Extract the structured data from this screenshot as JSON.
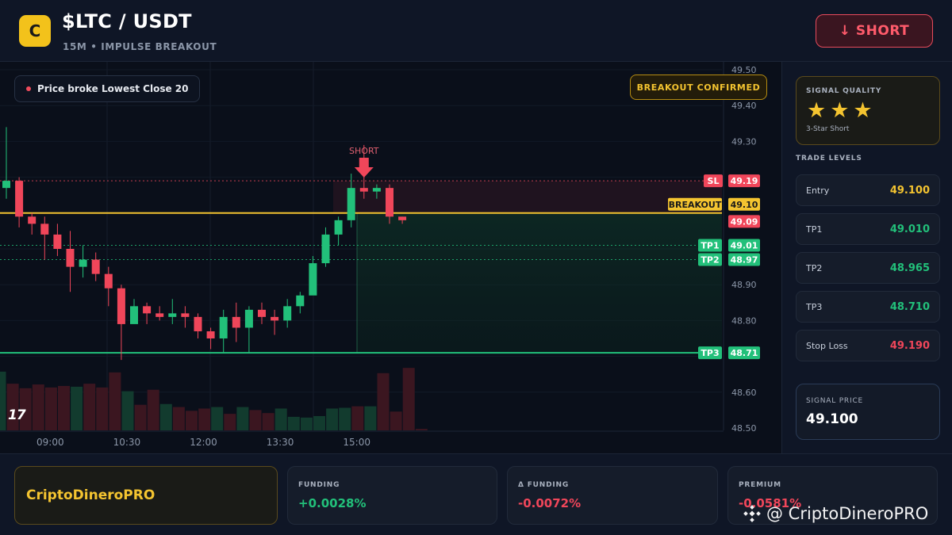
{
  "header": {
    "logo_letter": "C",
    "title": "$LTC / USDT",
    "subtitle": "15M • IMPULSE BREAKOUT",
    "short_button": "↓ SHORT"
  },
  "chart": {
    "signal_chip": "Price broke Lowest Close 20",
    "breakout_chip": "BREAKOUT CONFIRMED",
    "short_marker": "SHORT",
    "tv_logo": "17",
    "colors": {
      "up": "#22c07a",
      "down": "#f0465a",
      "breakout": "#f4c430",
      "tp": "#22c07a"
    }
  },
  "chart_data": {
    "type": "candlestick",
    "y_axis": {
      "ylim": [
        48.5,
        49.5
      ],
      "ticks": [
        "49.50",
        "49.40",
        "49.30",
        "48.90",
        "48.80",
        "48.60",
        "48.50"
      ]
    },
    "x_axis": {
      "ticks": [
        {
          "label": "09:00",
          "index": 3
        },
        {
          "label": "10:30",
          "index": 9
        },
        {
          "label": "12:00",
          "index": 15
        },
        {
          "label": "13:30",
          "index": 21
        },
        {
          "label": "15:00",
          "index": 27
        }
      ]
    },
    "candles": [
      [
        49.17,
        49.19,
        49.14,
        49.34
      ],
      [
        49.19,
        49.09,
        49.06,
        49.2
      ],
      [
        49.09,
        49.07,
        49.04,
        49.1
      ],
      [
        49.07,
        49.04,
        48.97,
        49.09
      ],
      [
        49.04,
        49.0,
        48.98,
        49.07
      ],
      [
        49.0,
        48.95,
        48.88,
        49.05
      ],
      [
        48.95,
        48.97,
        48.92,
        49.01
      ],
      [
        48.97,
        48.93,
        48.91,
        48.99
      ],
      [
        48.93,
        48.89,
        48.84,
        48.95
      ],
      [
        48.89,
        48.79,
        48.69,
        48.9
      ],
      [
        48.79,
        48.84,
        48.82,
        48.86
      ],
      [
        48.84,
        48.82,
        48.79,
        48.85
      ],
      [
        48.82,
        48.81,
        48.8,
        48.84
      ],
      [
        48.81,
        48.82,
        48.79,
        48.86
      ],
      [
        48.82,
        48.81,
        48.78,
        48.84
      ],
      [
        48.81,
        48.77,
        48.75,
        48.82
      ],
      [
        48.77,
        48.75,
        48.72,
        48.78
      ],
      [
        48.75,
        48.81,
        48.71,
        48.83
      ],
      [
        48.81,
        48.78,
        48.74,
        48.85
      ],
      [
        48.78,
        48.83,
        48.71,
        48.84
      ],
      [
        48.83,
        48.81,
        48.79,
        48.85
      ],
      [
        48.81,
        48.8,
        48.76,
        48.83
      ],
      [
        48.8,
        48.84,
        48.78,
        48.86
      ],
      [
        48.84,
        48.87,
        48.82,
        48.88
      ],
      [
        48.87,
        48.96,
        48.94,
        48.98
      ],
      [
        48.96,
        49.04,
        48.95,
        49.06
      ],
      [
        49.04,
        49.08,
        49.01,
        49.09
      ],
      [
        49.08,
        49.17,
        49.06,
        49.21
      ],
      [
        49.17,
        49.16,
        49.14,
        49.29
      ],
      [
        49.16,
        49.17,
        49.14,
        49.18
      ],
      [
        49.17,
        49.09,
        49.07,
        49.18
      ],
      [
        49.09,
        49.08,
        49.07,
        49.09
      ]
    ],
    "volume": [
      0.78,
      0.62,
      0.56,
      0.61,
      0.57,
      0.59,
      0.58,
      0.62,
      0.57,
      0.77,
      0.52,
      0.34,
      0.54,
      0.35,
      0.31,
      0.26,
      0.29,
      0.31,
      0.22,
      0.31,
      0.27,
      0.23,
      0.29,
      0.18,
      0.17,
      0.19,
      0.29,
      0.3,
      0.32,
      0.32,
      0.76,
      0.25,
      0.83,
      0.02
    ],
    "levels": {
      "sl": {
        "label": "SL",
        "value": "49.19",
        "price": 49.19
      },
      "breakout": {
        "label": "BREAKOUT",
        "value": "49.10",
        "price": 49.1
      },
      "current": {
        "value": "49.09",
        "price": 49.09
      },
      "tp1": {
        "label": "TP1",
        "value": "49.01",
        "price": 49.01
      },
      "tp2": {
        "label": "TP2",
        "value": "48.97",
        "price": 48.97
      },
      "tp3": {
        "label": "TP3",
        "value": "48.71",
        "price": 48.71
      }
    }
  },
  "side": {
    "quality_label": "SIGNAL QUALITY",
    "stars": "★★★",
    "quality_sub": "3-Star Short",
    "levels_title": "TRADE LEVELS",
    "levels": [
      {
        "name": "Entry",
        "value": "49.100",
        "color": "#f4c430"
      },
      {
        "name": "TP1",
        "value": "49.010",
        "color": "#22c07a"
      },
      {
        "name": "TP2",
        "value": "48.965",
        "color": "#22c07a"
      },
      {
        "name": "TP3",
        "value": "48.710",
        "color": "#22c07a"
      },
      {
        "name": "Stop Loss",
        "value": "49.190",
        "color": "#f0465a"
      }
    ],
    "signal_price_label": "SIGNAL PRICE",
    "signal_price": "49.100"
  },
  "footer": {
    "brand": "CriptoDineroPRO",
    "funding": {
      "label": "FUNDING",
      "value": "+0.0028%",
      "color": "#22c07a"
    },
    "delta_funding": {
      "label": "Δ FUNDING",
      "value": "-0.0072%",
      "color": "#f0465a"
    },
    "premium": {
      "label": "PREMIUM",
      "value": "-0.0581%",
      "color": "#f0465a"
    },
    "watermark": "@ CriptoDineroPRO"
  }
}
